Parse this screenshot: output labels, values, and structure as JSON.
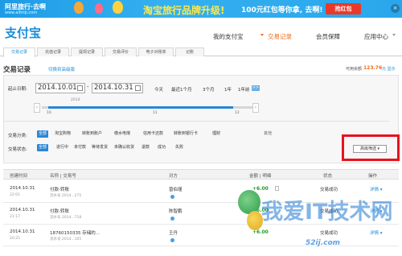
{
  "banner": {
    "site_name": "阿里旅行·去啊",
    "site_url": "www.alitrip.com",
    "headline": "淘宝旅行品牌升级!",
    "offer": "100元红包等你拿, 去啊!",
    "cta": "抢红包",
    "close": "×"
  },
  "header": {
    "logo": "支付宝",
    "nav": [
      {
        "label": "我的支付宝"
      },
      {
        "label": "交易记录"
      },
      {
        "label": "会员保障"
      },
      {
        "label": "应用中心"
      }
    ]
  },
  "subtabs": [
    "交易记录",
    "充值记录",
    "提现记录",
    "交易评价",
    "电子对账单",
    "记账"
  ],
  "page": {
    "title": "交易记录",
    "switch_link": "切换到高级版",
    "balance_label": "可用余额",
    "balance_value": "123.76",
    "balance_unit": "元",
    "balance_link": "显示"
  },
  "filters": {
    "start_label": "起止日期:",
    "start_date": "2014.10.01",
    "end_date": "2014.10.31",
    "dash": "-",
    "quick_ranges": [
      "今天",
      "最近1个月",
      "3个月",
      "1年",
      "1年前"
    ],
    "quick_more": ">>",
    "timeline_year": "2014",
    "timeline_months": [
      "10",
      "11",
      "12"
    ],
    "category_label": "交易分类:",
    "categories": [
      "全部",
      "淘宝购物",
      "转账到账户",
      "缴水电煤",
      "信用卡还款",
      "转账到银行卡",
      "理财"
    ],
    "category_more": "其他",
    "status_label": "交易状态:",
    "statuses": [
      "全部",
      "进行中",
      "未付款",
      "等待发货",
      "未确认收货",
      "退款",
      "成功",
      "失败"
    ],
    "advanced_button": "高级筛选"
  },
  "table": {
    "headers": [
      "创建时间",
      "名称 | 交易号",
      "对方",
      "金额 | 明细",
      "状态",
      "操作"
    ],
    "rows": [
      {
        "date": "2014.10.31",
        "time": "22:01",
        "name": "付款-转账",
        "serial": "流水号 2014...275",
        "party": "曾伯瑾",
        "amount": "+6.00",
        "status": "交易成功",
        "action": "详情"
      },
      {
        "date": "2014.10.31",
        "time": "21:17",
        "name": "付款-转账",
        "serial": "流水号 2014...718",
        "party": "陈智鹏",
        "amount": "+6.00",
        "status": "交易成功",
        "action": "详情"
      },
      {
        "date": "2014.10.31",
        "time": "20:25",
        "name": "18760150335 存储的...",
        "serial": "流水号 2014...105",
        "party": "王丹",
        "amount": "+6.00",
        "status": "交易成功",
        "action": "详情"
      }
    ]
  },
  "watermark": {
    "text": "我爱IT技术网",
    "url": "52ij.com"
  }
}
